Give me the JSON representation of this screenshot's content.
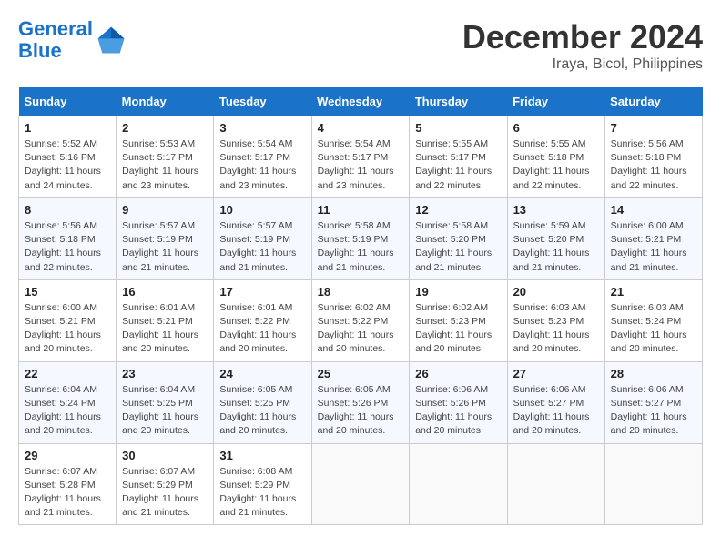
{
  "logo": {
    "line1": "General",
    "line2": "Blue"
  },
  "title": "December 2024",
  "location": "Iraya, Bicol, Philippines",
  "weekdays": [
    "Sunday",
    "Monday",
    "Tuesday",
    "Wednesday",
    "Thursday",
    "Friday",
    "Saturday"
  ],
  "weeks": [
    [
      {
        "day": "1",
        "info": "Sunrise: 5:52 AM\nSunset: 5:16 PM\nDaylight: 11 hours\nand 24 minutes."
      },
      {
        "day": "2",
        "info": "Sunrise: 5:53 AM\nSunset: 5:17 PM\nDaylight: 11 hours\nand 23 minutes."
      },
      {
        "day": "3",
        "info": "Sunrise: 5:54 AM\nSunset: 5:17 PM\nDaylight: 11 hours\nand 23 minutes."
      },
      {
        "day": "4",
        "info": "Sunrise: 5:54 AM\nSunset: 5:17 PM\nDaylight: 11 hours\nand 23 minutes."
      },
      {
        "day": "5",
        "info": "Sunrise: 5:55 AM\nSunset: 5:17 PM\nDaylight: 11 hours\nand 22 minutes."
      },
      {
        "day": "6",
        "info": "Sunrise: 5:55 AM\nSunset: 5:18 PM\nDaylight: 11 hours\nand 22 minutes."
      },
      {
        "day": "7",
        "info": "Sunrise: 5:56 AM\nSunset: 5:18 PM\nDaylight: 11 hours\nand 22 minutes."
      }
    ],
    [
      {
        "day": "8",
        "info": "Sunrise: 5:56 AM\nSunset: 5:18 PM\nDaylight: 11 hours\nand 22 minutes."
      },
      {
        "day": "9",
        "info": "Sunrise: 5:57 AM\nSunset: 5:19 PM\nDaylight: 11 hours\nand 21 minutes."
      },
      {
        "day": "10",
        "info": "Sunrise: 5:57 AM\nSunset: 5:19 PM\nDaylight: 11 hours\nand 21 minutes."
      },
      {
        "day": "11",
        "info": "Sunrise: 5:58 AM\nSunset: 5:19 PM\nDaylight: 11 hours\nand 21 minutes."
      },
      {
        "day": "12",
        "info": "Sunrise: 5:58 AM\nSunset: 5:20 PM\nDaylight: 11 hours\nand 21 minutes."
      },
      {
        "day": "13",
        "info": "Sunrise: 5:59 AM\nSunset: 5:20 PM\nDaylight: 11 hours\nand 21 minutes."
      },
      {
        "day": "14",
        "info": "Sunrise: 6:00 AM\nSunset: 5:21 PM\nDaylight: 11 hours\nand 21 minutes."
      }
    ],
    [
      {
        "day": "15",
        "info": "Sunrise: 6:00 AM\nSunset: 5:21 PM\nDaylight: 11 hours\nand 20 minutes."
      },
      {
        "day": "16",
        "info": "Sunrise: 6:01 AM\nSunset: 5:21 PM\nDaylight: 11 hours\nand 20 minutes."
      },
      {
        "day": "17",
        "info": "Sunrise: 6:01 AM\nSunset: 5:22 PM\nDaylight: 11 hours\nand 20 minutes."
      },
      {
        "day": "18",
        "info": "Sunrise: 6:02 AM\nSunset: 5:22 PM\nDaylight: 11 hours\nand 20 minutes."
      },
      {
        "day": "19",
        "info": "Sunrise: 6:02 AM\nSunset: 5:23 PM\nDaylight: 11 hours\nand 20 minutes."
      },
      {
        "day": "20",
        "info": "Sunrise: 6:03 AM\nSunset: 5:23 PM\nDaylight: 11 hours\nand 20 minutes."
      },
      {
        "day": "21",
        "info": "Sunrise: 6:03 AM\nSunset: 5:24 PM\nDaylight: 11 hours\nand 20 minutes."
      }
    ],
    [
      {
        "day": "22",
        "info": "Sunrise: 6:04 AM\nSunset: 5:24 PM\nDaylight: 11 hours\nand 20 minutes."
      },
      {
        "day": "23",
        "info": "Sunrise: 6:04 AM\nSunset: 5:25 PM\nDaylight: 11 hours\nand 20 minutes."
      },
      {
        "day": "24",
        "info": "Sunrise: 6:05 AM\nSunset: 5:25 PM\nDaylight: 11 hours\nand 20 minutes."
      },
      {
        "day": "25",
        "info": "Sunrise: 6:05 AM\nSunset: 5:26 PM\nDaylight: 11 hours\nand 20 minutes."
      },
      {
        "day": "26",
        "info": "Sunrise: 6:06 AM\nSunset: 5:26 PM\nDaylight: 11 hours\nand 20 minutes."
      },
      {
        "day": "27",
        "info": "Sunrise: 6:06 AM\nSunset: 5:27 PM\nDaylight: 11 hours\nand 20 minutes."
      },
      {
        "day": "28",
        "info": "Sunrise: 6:06 AM\nSunset: 5:27 PM\nDaylight: 11 hours\nand 20 minutes."
      }
    ],
    [
      {
        "day": "29",
        "info": "Sunrise: 6:07 AM\nSunset: 5:28 PM\nDaylight: 11 hours\nand 21 minutes."
      },
      {
        "day": "30",
        "info": "Sunrise: 6:07 AM\nSunset: 5:29 PM\nDaylight: 11 hours\nand 21 minutes."
      },
      {
        "day": "31",
        "info": "Sunrise: 6:08 AM\nSunset: 5:29 PM\nDaylight: 11 hours\nand 21 minutes."
      },
      {
        "day": "",
        "info": ""
      },
      {
        "day": "",
        "info": ""
      },
      {
        "day": "",
        "info": ""
      },
      {
        "day": "",
        "info": ""
      }
    ]
  ]
}
